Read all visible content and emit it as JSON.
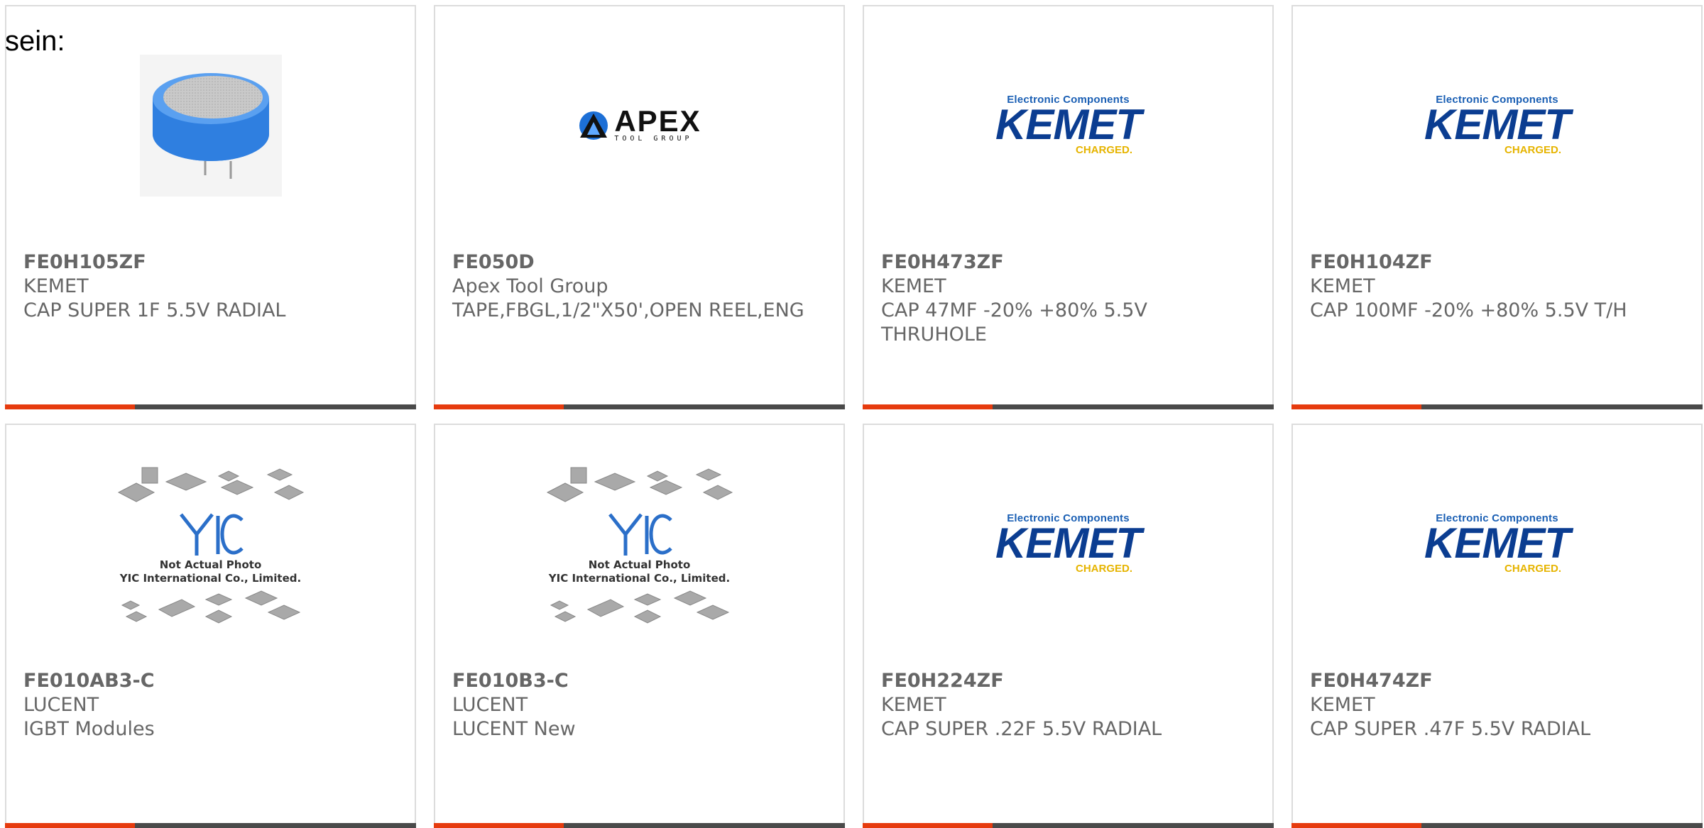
{
  "lead_text": "sein:",
  "cards": [
    {
      "part_number": "FE0H105ZF",
      "manufacturer": "KEMET",
      "description": "CAP SUPER 1F 5.5V RADIAL",
      "image": "supercapacitor-photo"
    },
    {
      "part_number": "FE050D",
      "manufacturer": "Apex Tool Group",
      "description": "TAPE,FBGL,1/2\"X50',OPEN REEL,ENG",
      "image": "apex-logo",
      "logo": {
        "word": "APEX",
        "sub": "TOOL GROUP"
      }
    },
    {
      "part_number": "FE0H473ZF",
      "manufacturer": "KEMET",
      "description": "CAP 47MF -20% +80% 5.5V THRUHOLE",
      "image": "kemet-logo",
      "logo": {
        "tag": "Electronic Components",
        "word": "KEMET",
        "sub": "CHARGED."
      }
    },
    {
      "part_number": "FE0H104ZF",
      "manufacturer": "KEMET",
      "description": "CAP 100MF -20% +80% 5.5V T/H",
      "image": "kemet-logo",
      "logo": {
        "tag": "Electronic Components",
        "word": "KEMET",
        "sub": "CHARGED."
      }
    },
    {
      "part_number": "FE010AB3-C",
      "manufacturer": "LUCENT",
      "description": "IGBT Modules",
      "image": "yic-placeholder",
      "logo": {
        "line1": "Not Actual Photo",
        "line2": "YIC International Co., Limited."
      }
    },
    {
      "part_number": "FE010B3-C",
      "manufacturer": "LUCENT",
      "description": "LUCENT New",
      "image": "yic-placeholder",
      "logo": {
        "line1": "Not Actual Photo",
        "line2": "YIC International Co., Limited."
      }
    },
    {
      "part_number": "FE0H224ZF",
      "manufacturer": "KEMET",
      "description": "CAP SUPER .22F 5.5V RADIAL",
      "image": "kemet-logo",
      "logo": {
        "tag": "Electronic Components",
        "word": "KEMET",
        "sub": "CHARGED."
      }
    },
    {
      "part_number": "FE0H474ZF",
      "manufacturer": "KEMET",
      "description": "CAP SUPER .47F 5.5V RADIAL",
      "image": "kemet-logo",
      "logo": {
        "tag": "Electronic Components",
        "word": "KEMET",
        "sub": "CHARGED."
      }
    }
  ],
  "colors": {
    "accent_bar": "#e63b0e",
    "bar": "#4a4a4a",
    "text": "#666666",
    "kemet_blue": "#0b3d91",
    "kemet_yellow": "#e6b400"
  }
}
